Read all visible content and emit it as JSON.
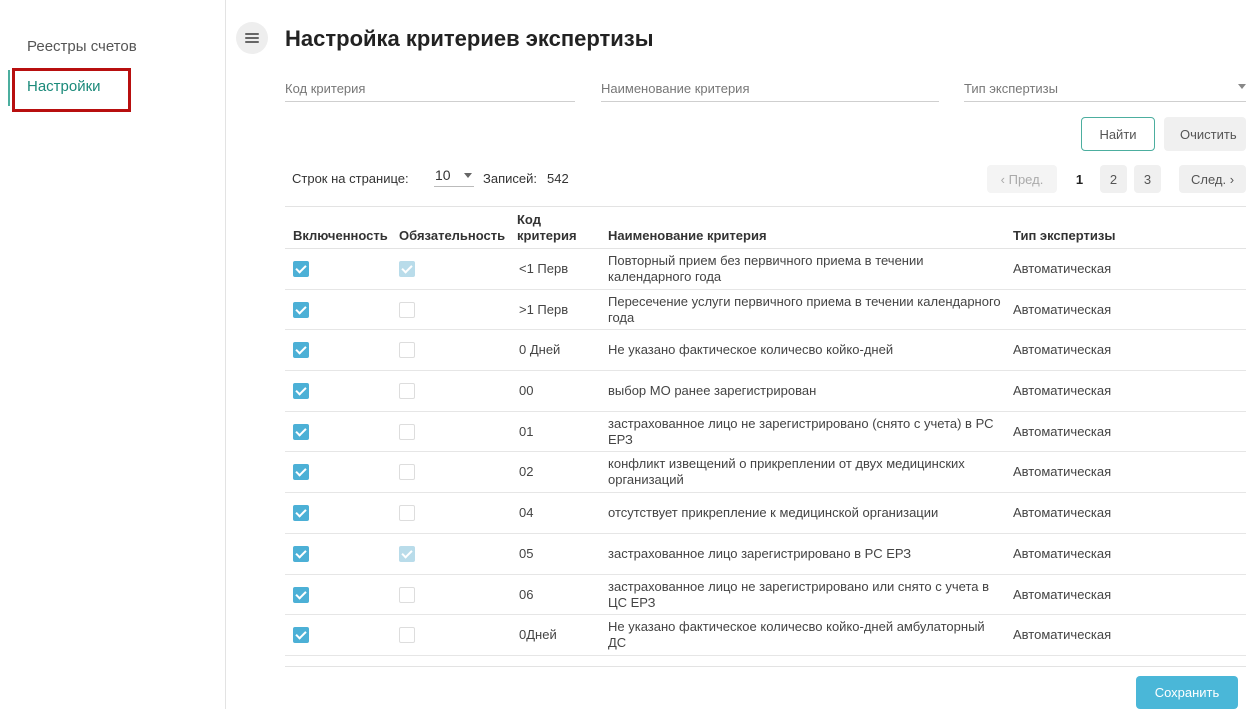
{
  "sidebar": {
    "items": [
      {
        "label": "Реестры счетов"
      },
      {
        "label": "Настройки"
      }
    ]
  },
  "header": {
    "title": "Настройка критериев экспертизы"
  },
  "filters": {
    "code_placeholder": "Код критерия",
    "name_placeholder": "Наименование критерия",
    "type_placeholder": "Тип экспертизы"
  },
  "buttons": {
    "find": "Найти",
    "clear": "Очистить",
    "save": "Сохранить"
  },
  "pagination": {
    "rows_label": "Строк на странице:",
    "rows_value": "10",
    "records_label": "Записей:",
    "records_value": "542",
    "prev": "‹ Пред.",
    "pages": [
      "1",
      "2",
      "3"
    ],
    "current_page": "1",
    "next": "След. ›"
  },
  "table": {
    "headers": {
      "enabled": "Включенность",
      "required": "Обязательность",
      "code_line1": "Код",
      "code_line2": "критерия",
      "name": "Наименование критерия",
      "type": "Тип экспертизы"
    },
    "rows": [
      {
        "enabled": true,
        "required": true,
        "code": "<1 Перв",
        "name": "Повторный прием без первичного приема в течении календарного года",
        "type": "Автоматическая"
      },
      {
        "enabled": true,
        "required": false,
        "code": ">1 Перв",
        "name": "Пересечение услуги первичного приема в течении календарного года",
        "type": "Автоматическая"
      },
      {
        "enabled": true,
        "required": false,
        "code": "0 Дней",
        "name": "Не указано фактическое количесво койко-дней",
        "type": "Автоматическая"
      },
      {
        "enabled": true,
        "required": false,
        "code": "00",
        "name": "выбор МО ранее зарегистрирован",
        "type": "Автоматическая"
      },
      {
        "enabled": true,
        "required": false,
        "code": "01",
        "name": "застрахованное лицо не зарегистрировано (снято с учета) в РС ЕРЗ",
        "type": "Автоматическая"
      },
      {
        "enabled": true,
        "required": false,
        "code": "02",
        "name": "конфликт извещений о прикреплении от двух медицинских организаций",
        "type": "Автоматическая"
      },
      {
        "enabled": true,
        "required": false,
        "code": "04",
        "name": "отсутствует прикрепление к медицинской организации",
        "type": "Автоматическая"
      },
      {
        "enabled": true,
        "required": true,
        "code": "05",
        "name": "застрахованное лицо зарегистрировано в РС ЕРЗ",
        "type": "Автоматическая"
      },
      {
        "enabled": true,
        "required": false,
        "code": "06",
        "name": "застрахованное лицо не зарегистрировано или снято с учета в ЦС ЕРЗ",
        "type": "Автоматическая"
      },
      {
        "enabled": true,
        "required": false,
        "code": "0Дней",
        "name": "Не указано фактическое количесво койко-дней амбулаторный ДС",
        "type": "Автоматическая"
      }
    ]
  }
}
